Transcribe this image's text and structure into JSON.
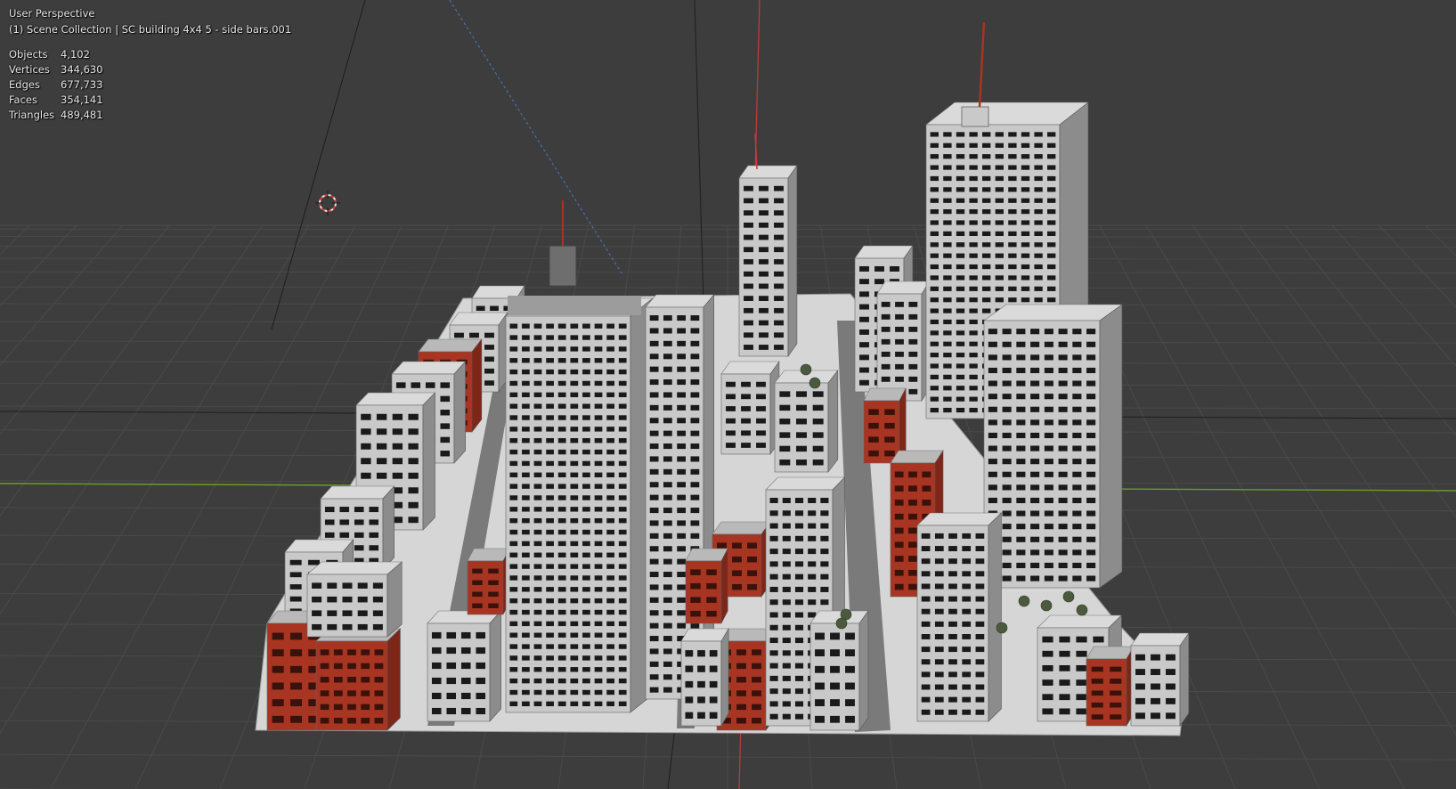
{
  "viewport": {
    "view_name": "User Perspective",
    "collection_line": "(1) Scene Collection | SC building 4x4 5 - side bars.001",
    "stats": [
      {
        "label": "Objects",
        "value": "4,102"
      },
      {
        "label": "Vertices",
        "value": "344,630"
      },
      {
        "label": "Edges",
        "value": "677,733"
      },
      {
        "label": "Faces",
        "value": "354,141"
      },
      {
        "label": "Triangles",
        "value": "489,481"
      }
    ]
  },
  "colors": {
    "background": "#3d3d3d",
    "grid_line": "#4a4a4a",
    "axis_x": "#c43b3b",
    "axis_y": "#6d9a2a",
    "axis_z": "#4a78c8",
    "building_light": "#c9c9c9",
    "building_dark": "#8c8c8c",
    "brick_red": "#a83422",
    "window": "#1a1a1a",
    "ground": "#d6d6d6"
  },
  "icons": {
    "cursor": "3d-cursor-icon"
  }
}
